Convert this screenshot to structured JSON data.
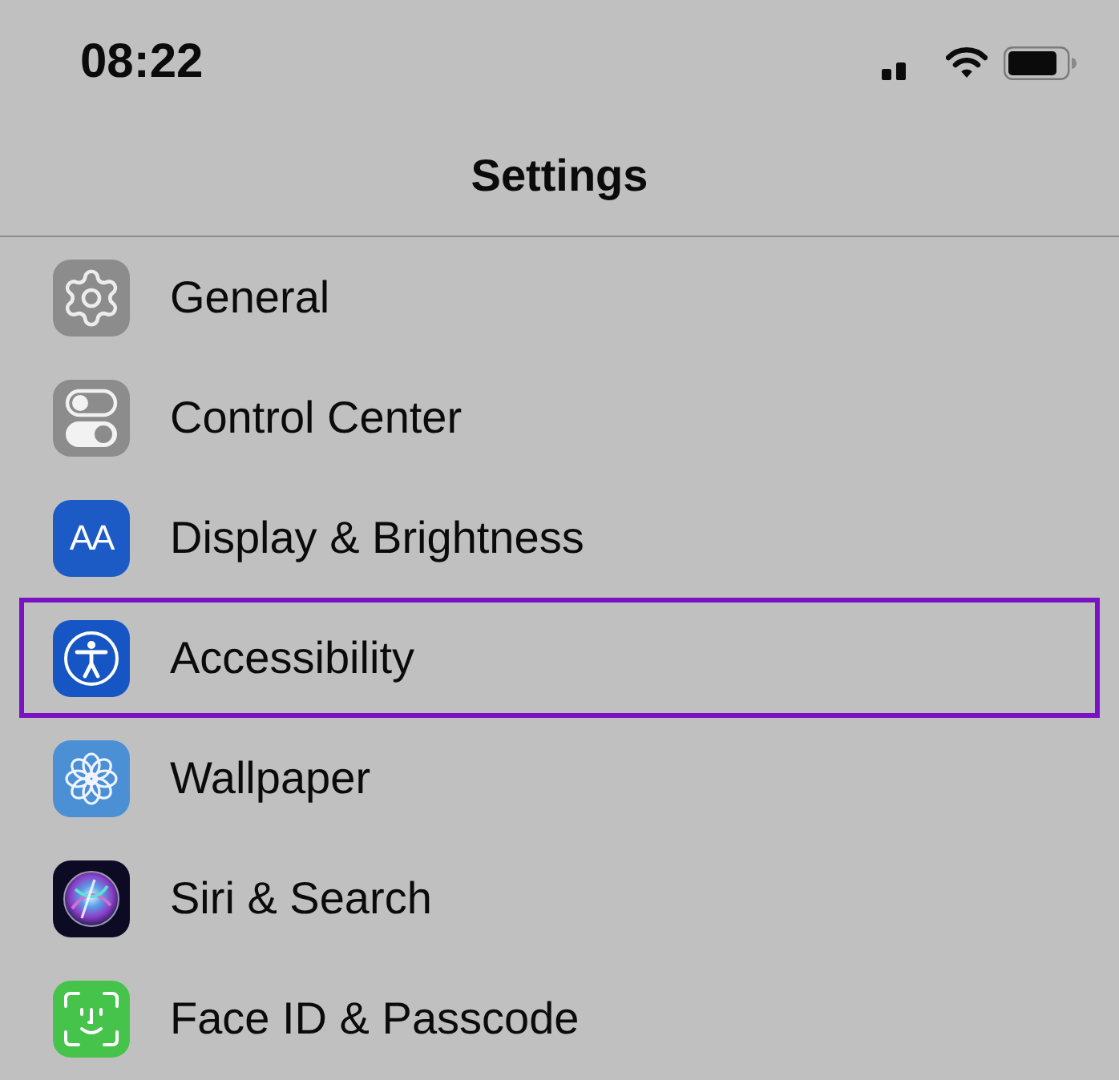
{
  "status_bar": {
    "time": "08:22"
  },
  "nav": {
    "title": "Settings"
  },
  "items": [
    {
      "label": "General",
      "highlighted": false
    },
    {
      "label": "Control Center",
      "highlighted": false
    },
    {
      "label": "Display & Brightness",
      "icon_text": "AA",
      "highlighted": false
    },
    {
      "label": "Accessibility",
      "highlighted": true
    },
    {
      "label": "Wallpaper",
      "highlighted": false
    },
    {
      "label": "Siri & Search",
      "highlighted": false
    },
    {
      "label": "Face ID & Passcode",
      "highlighted": false
    }
  ]
}
